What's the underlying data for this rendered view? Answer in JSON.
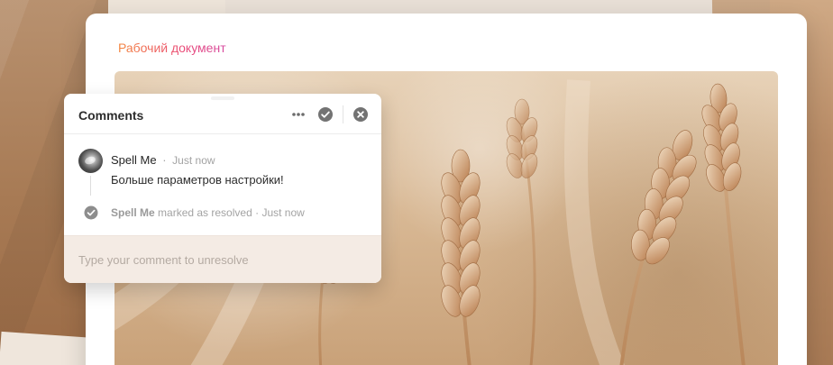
{
  "document": {
    "title": "Рабочий документ"
  },
  "comments_panel": {
    "title": "Comments",
    "comment": {
      "author": "Spell Me",
      "time_separator": "·",
      "time": "Just now",
      "text": "Больше параметров настройки!"
    },
    "resolution": {
      "user": "Spell Me",
      "action": "marked as resolved",
      "separator": "·",
      "time": "Just now"
    },
    "input": {
      "placeholder": "Type your comment to unresolve",
      "value": ""
    }
  },
  "icons": {
    "more": "more-horizontal-icon",
    "resolve": "check-circle-icon",
    "close": "close-circle-icon",
    "resolved_status": "check-circle-icon"
  },
  "colors": {
    "title_gradient_start": "#f4853d",
    "title_gradient_end": "#d64aa0",
    "icon_gray": "#707070",
    "input_background": "#f4ebe4",
    "muted_text": "#a3a3a3"
  }
}
